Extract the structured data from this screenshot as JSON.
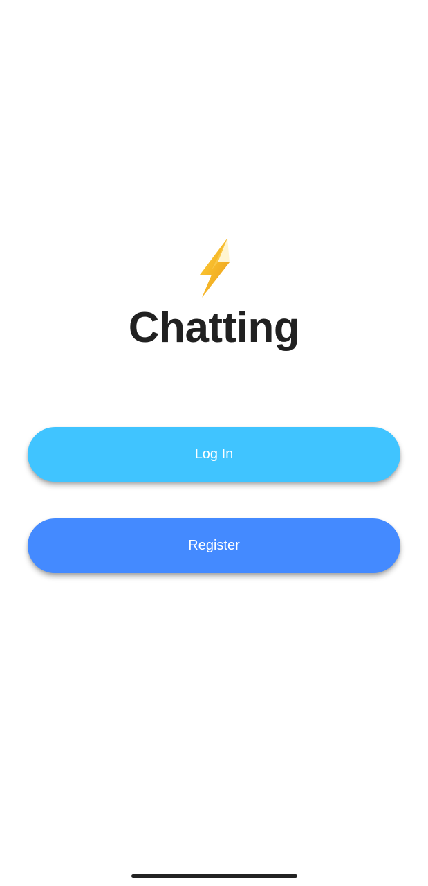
{
  "app": {
    "title": "Chatting",
    "logo_icon": "lightning-bolt-icon"
  },
  "actions": {
    "login_label": "Log In",
    "register_label": "Register"
  },
  "colors": {
    "login_button": "#40c4ff",
    "register_button": "#448aff",
    "title_text": "#212121",
    "bolt_light": "#ffc928",
    "bolt_dark": "#f0a21a",
    "background": "#ffffff"
  }
}
